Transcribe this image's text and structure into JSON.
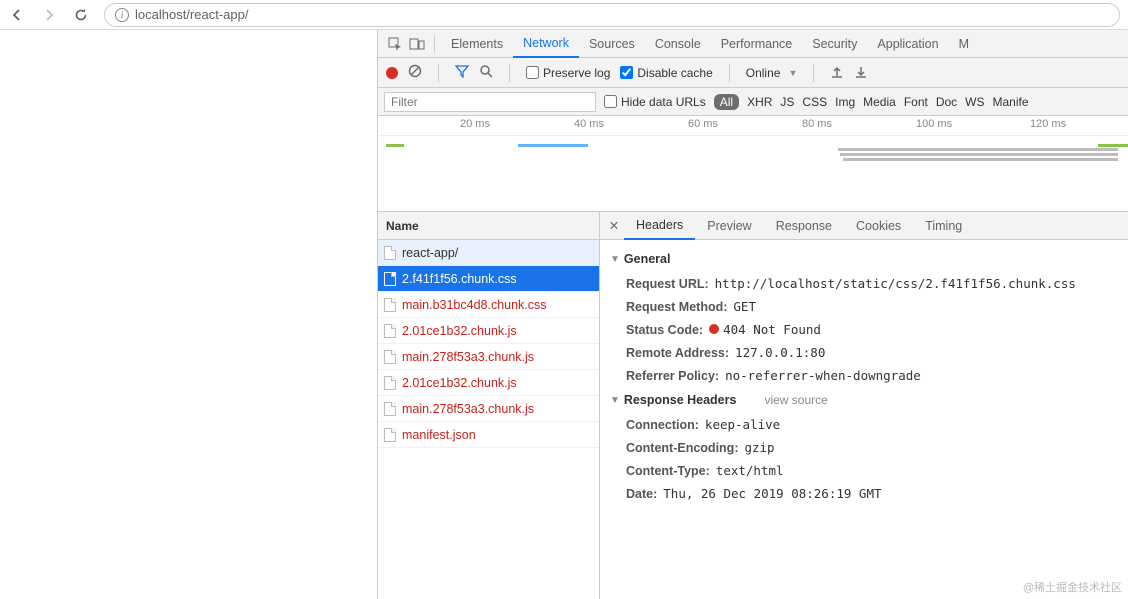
{
  "browser": {
    "url": "localhost/react-app/"
  },
  "devtools": {
    "tabs": [
      "Elements",
      "Network",
      "Sources",
      "Console",
      "Performance",
      "Security",
      "Application",
      "M"
    ],
    "activeTab": 1,
    "toolbar": {
      "preserve_log": "Preserve log",
      "disable_cache": "Disable cache",
      "throttle": "Online"
    },
    "filters": {
      "placeholder": "Filter",
      "hide_data_urls": "Hide data URLs",
      "types": [
        "All",
        "XHR",
        "JS",
        "CSS",
        "Img",
        "Media",
        "Font",
        "Doc",
        "WS",
        "Manife"
      ]
    },
    "timeline": {
      "ticks": [
        "20 ms",
        "40 ms",
        "60 ms",
        "80 ms",
        "100 ms",
        "120 ms"
      ]
    },
    "list": {
      "header": "Name",
      "rows": [
        {
          "name": "react-app/",
          "err": false
        },
        {
          "name": "2.f41f1f56.chunk.css",
          "err": false,
          "selected": true
        },
        {
          "name": "main.b31bc4d8.chunk.css",
          "err": true
        },
        {
          "name": "2.01ce1b32.chunk.js",
          "err": true
        },
        {
          "name": "main.278f53a3.chunk.js",
          "err": true
        },
        {
          "name": "2.01ce1b32.chunk.js",
          "err": true
        },
        {
          "name": "main.278f53a3.chunk.js",
          "err": true
        },
        {
          "name": "manifest.json",
          "err": true
        }
      ]
    },
    "details": {
      "tabs": [
        "Headers",
        "Preview",
        "Response",
        "Cookies",
        "Timing"
      ],
      "activeTab": 0,
      "general_label": "General",
      "general": [
        {
          "k": "Request URL:",
          "v": "http://localhost/static/css/2.f41f1f56.chunk.css",
          "mono": true
        },
        {
          "k": "Request Method:",
          "v": "GET",
          "mono": true
        },
        {
          "k": "Status Code:",
          "v": "404 Not Found",
          "mono": true,
          "status": true
        },
        {
          "k": "Remote Address:",
          "v": "127.0.0.1:80",
          "mono": true
        },
        {
          "k": "Referrer Policy:",
          "v": "no-referrer-when-downgrade",
          "mono": true
        }
      ],
      "response_headers_label": "Response Headers",
      "view_source": "view source",
      "response_headers": [
        {
          "k": "Connection:",
          "v": "keep-alive",
          "mono": true
        },
        {
          "k": "Content-Encoding:",
          "v": "gzip",
          "mono": true
        },
        {
          "k": "Content-Type:",
          "v": "text/html",
          "mono": true
        },
        {
          "k": "Date:",
          "v": "Thu, 26 Dec 2019 08:26:19 GMT",
          "mono": true
        }
      ]
    }
  },
  "watermark": "@稀土掘金技术社区"
}
